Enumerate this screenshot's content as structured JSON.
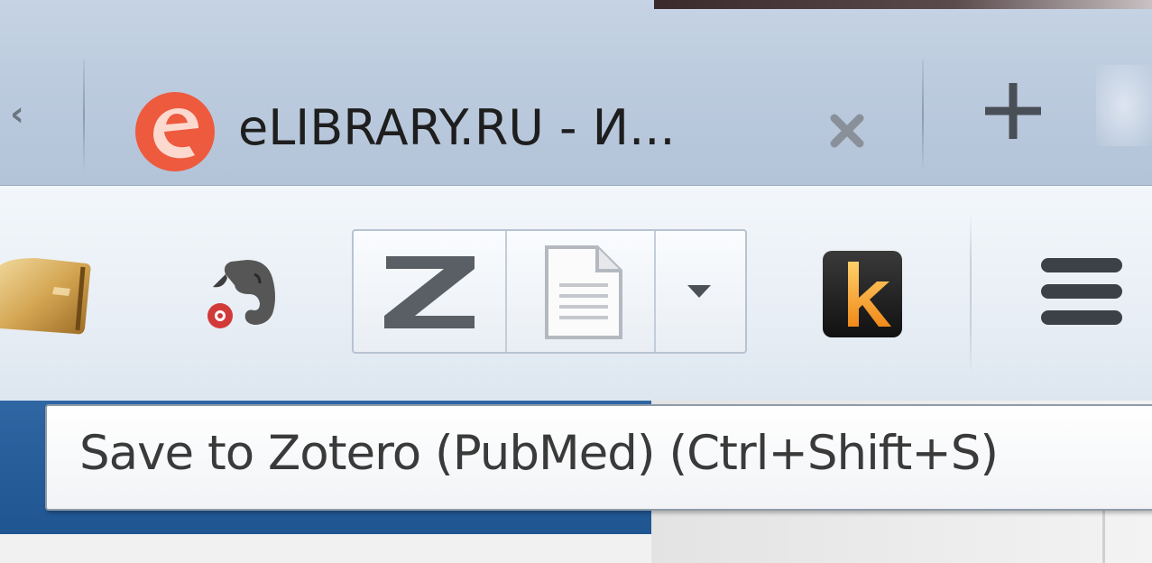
{
  "tab_strip": {
    "scroll_left_glyph": "‹",
    "active_tab": {
      "title": "eLIBRARY.RU - И...",
      "favicon": "elibrary-e-icon",
      "close_glyph": "×"
    },
    "new_tab_glyph": "+"
  },
  "toolbar": {
    "icons": [
      "bookmark-book-icon",
      "evernote-elephant-icon",
      "zotero-z-icon",
      "zotero-save-page-icon",
      "dropdown-arrow-icon",
      "k-extension-icon",
      "hamburger-menu-icon"
    ],
    "zotero_letter": "Z",
    "k_letter": "k"
  },
  "tooltip": {
    "text": "Save to Zotero (PubMed) (Ctrl+Shift+S)"
  },
  "colors": {
    "tab_strip_bg": "#bccbde",
    "toolbar_bg": "#e8eef5",
    "elibrary_orange": "#ee5a3e",
    "page_header_blue": "#2f66a3",
    "tooltip_border": "#8f9aa8"
  }
}
